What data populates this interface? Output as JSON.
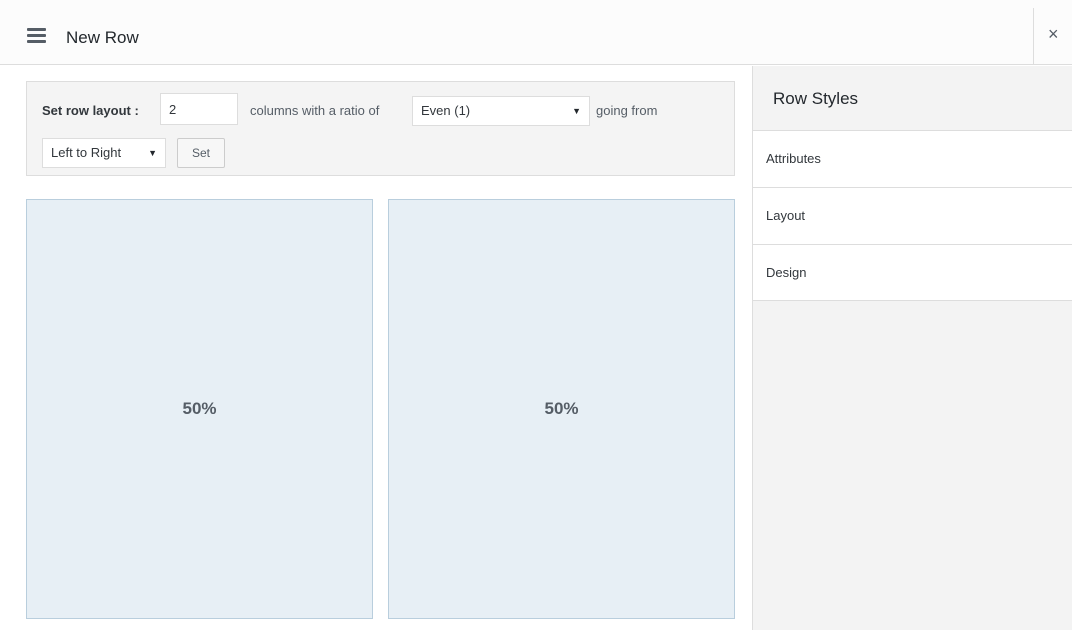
{
  "header": {
    "title": "New Row",
    "menu_icon": "hamburger-menu-icon",
    "close_label": "×"
  },
  "layout_bar": {
    "label": "Set row layout :",
    "columns_value": "2",
    "columns_text": "columns with a ratio of",
    "ratio_selected": "Even (1)",
    "direction_text": "going from",
    "direction_selected": "Left to Right",
    "set_label": "Set"
  },
  "cells": [
    {
      "label": "50%",
      "width_percent": 50
    },
    {
      "label": "50%",
      "width_percent": 50
    }
  ],
  "sidebar": {
    "title": "Row Styles",
    "items": [
      {
        "label": "Attributes"
      },
      {
        "label": "Layout"
      },
      {
        "label": "Design"
      }
    ]
  }
}
